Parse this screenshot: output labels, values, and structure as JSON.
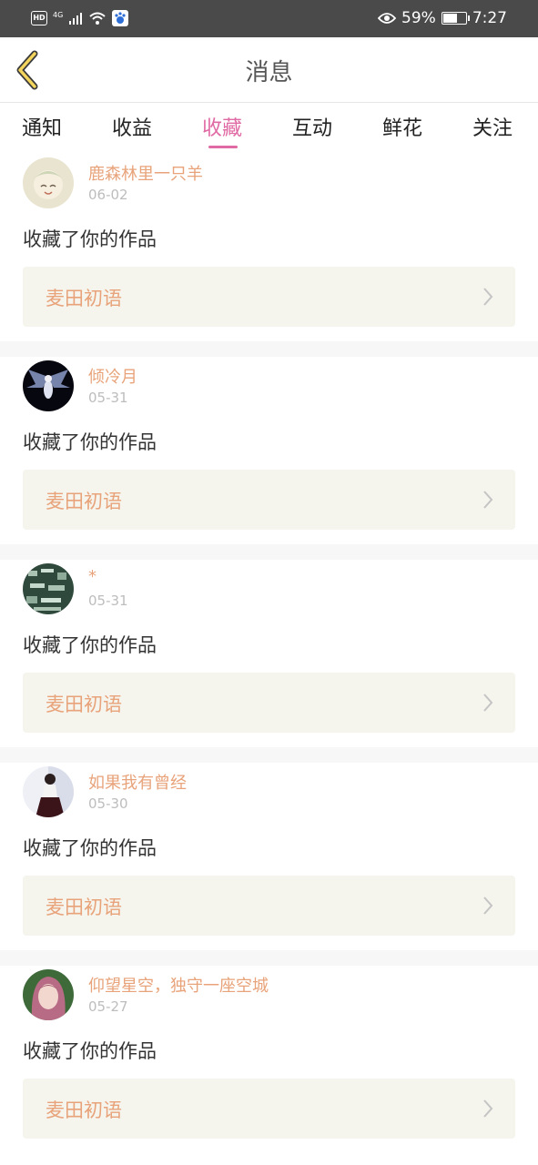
{
  "status_bar": {
    "hd_label": "HD",
    "network_label": "4G",
    "battery_text": "59%",
    "battery_level": 0.59,
    "time": "7:27"
  },
  "header": {
    "title": "消息",
    "back_icon": "chevron-left-icon"
  },
  "tabs": [
    {
      "label": "通知",
      "active": false
    },
    {
      "label": "收益",
      "active": false
    },
    {
      "label": "收藏",
      "active": true
    },
    {
      "label": "互动",
      "active": false
    },
    {
      "label": "鲜花",
      "active": false
    },
    {
      "label": "关注",
      "active": false
    }
  ],
  "colors": {
    "accent": "#e06aa4",
    "username": "#e8a37a",
    "work_box_bg": "#f5f4ed"
  },
  "messages": [
    {
      "username": "鹿森林里一只羊",
      "date": "06-02",
      "action": "收藏了你的作品",
      "work": "麦田初语"
    },
    {
      "username": "倾冷月",
      "date": "05-31",
      "action": "收藏了你的作品",
      "work": "麦田初语"
    },
    {
      "username": "*",
      "date": "05-31",
      "action": "收藏了你的作品",
      "work": "麦田初语"
    },
    {
      "username": "如果我有曾经",
      "date": "05-30",
      "action": "收藏了你的作品",
      "work": "麦田初语"
    },
    {
      "username": "仰望星空，独守一座空城",
      "date": "05-27",
      "action": "收藏了你的作品",
      "work": "麦田初语"
    }
  ]
}
